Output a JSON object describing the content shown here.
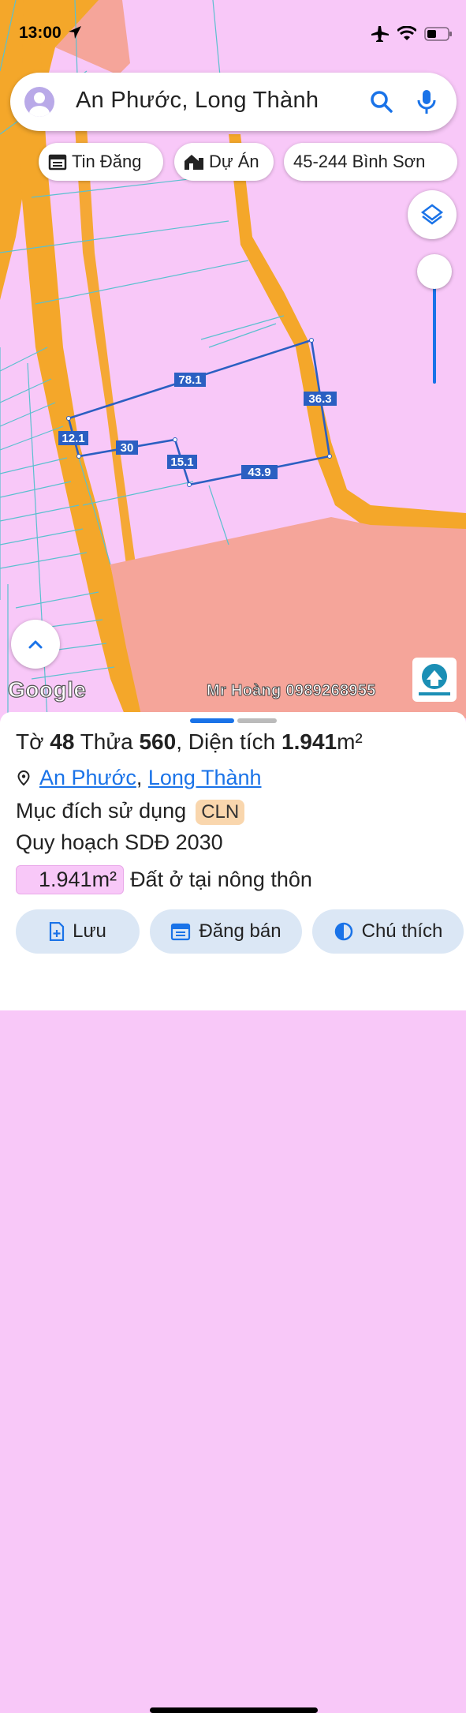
{
  "status": {
    "time": "13:00"
  },
  "search": {
    "text": "An Phước, Long Thành"
  },
  "chips": [
    {
      "label": "Tin Đăng"
    },
    {
      "label": "Dự Án"
    },
    {
      "label": "45-244 Bình Sơn"
    }
  ],
  "map": {
    "measurements": [
      "78.1",
      "36.3",
      "12.1",
      "30",
      "15.1",
      "43.9"
    ],
    "google_label": "Google",
    "watermark": "Mr Hoàng 0989268955",
    "colors": {
      "residential": "#f8c8f8",
      "road": "#f4a72a",
      "zone": "#f5a59a",
      "parcel_outline": "#2b5fc2"
    }
  },
  "sheet": {
    "title_prefix": "Tờ",
    "sheet_no": "48",
    "parcel_label": "Thửa",
    "parcel_no": "560",
    "area_label": ", Diện tích",
    "area_value": "1.941",
    "area_unit": "m²",
    "location_1": "An Phước",
    "location_sep": ",",
    "location_2": "Long Thành",
    "purpose_label": "Mục đích sử dụng",
    "purpose_code": "CLN",
    "plan_label": "Quy hoạch SDĐ 2030",
    "plan_area": "1.941m²",
    "plan_type": "Đất ở tại nông thôn"
  },
  "actions": {
    "save": "Lưu",
    "post": "Đăng bán",
    "legend": "Chú thích"
  }
}
